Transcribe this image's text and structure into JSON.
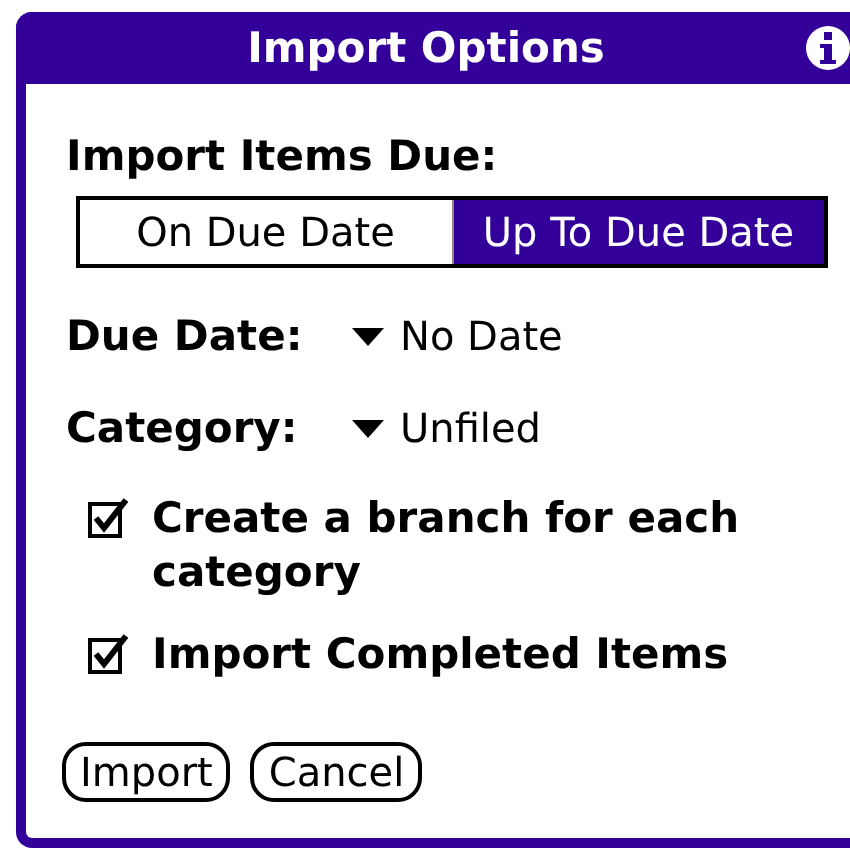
{
  "window": {
    "title": "Import Options"
  },
  "import_items_due": {
    "label": "Import Items Due:",
    "options": [
      {
        "label": "On Due Date",
        "selected": false
      },
      {
        "label": "Up To Due Date",
        "selected": true
      }
    ]
  },
  "fields": [
    {
      "label": "Due Date:",
      "value": "No Date"
    },
    {
      "label": "Category:",
      "value": "Unfiled"
    }
  ],
  "checkboxes": [
    {
      "label": "Create a branch for each category",
      "checked": true
    },
    {
      "label": "Import Completed Items",
      "checked": true
    }
  ],
  "buttons": [
    "Import",
    "Cancel"
  ]
}
